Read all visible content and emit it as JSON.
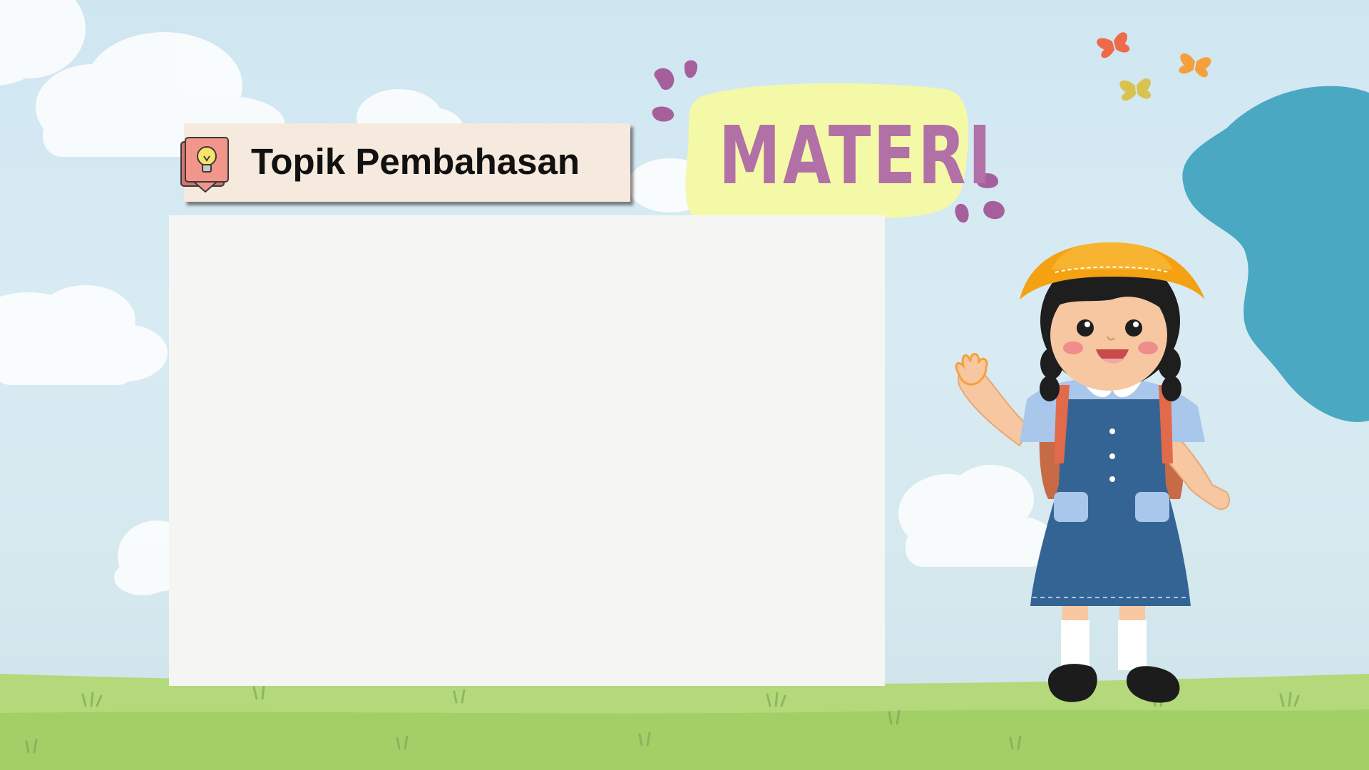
{
  "slide": {
    "topic_label": "Topik Pembahasan",
    "title_tag": "MATERI"
  },
  "icons": {
    "topic": "book-lightbulb-icon",
    "character": "schoolgirl-illustration",
    "butterflies": "butterfly-icon"
  },
  "colors": {
    "sky": "#d6e9f1",
    "grass": "#a9d46c",
    "title_text": "#b271a6",
    "title_background": "#f4f9a8",
    "topic_background": "#f6e9dd",
    "blob": "#4aa8c3",
    "panel": "#f5f6f4"
  }
}
